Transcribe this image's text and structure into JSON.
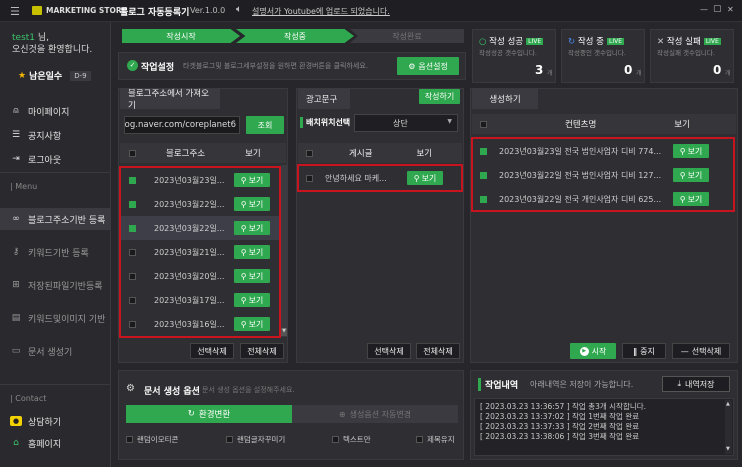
{
  "titlebar": {
    "brand": "MARKETING STORE",
    "app_title": "블로그 자동등록기",
    "version": "Ver.1.0.0",
    "notice": "설명서가 Youtube에 업로드 되었습니다.",
    "win_min": "—",
    "win_max": "▢",
    "win_close": "✕"
  },
  "sidebar": {
    "user": "test1",
    "user_suffix": "님,",
    "welcome": "오신것을 환영합니다.",
    "days_left_label": "남은일수",
    "days_left_value": "D-9",
    "items": [
      {
        "label": "마이페이지",
        "icon": "user-icon"
      },
      {
        "label": "공지사항",
        "icon": "list-icon"
      },
      {
        "label": "로그아웃",
        "icon": "logout-icon"
      }
    ],
    "menu_header": "| Menu",
    "menu": [
      {
        "label": "블로그주소기반 등록",
        "icon": "link-icon"
      },
      {
        "label": "키워드기반 등록",
        "icon": "key-icon"
      },
      {
        "label": "저장된파일기반등록",
        "icon": "file-plus-icon"
      },
      {
        "label": "키워드및이미지 기반",
        "icon": "image-doc-icon"
      },
      {
        "label": "문서 생성기",
        "icon": "doc-icon"
      }
    ],
    "contact_header": "| Contact",
    "contact": [
      {
        "label": "상담하기",
        "icon": "chat-icon"
      },
      {
        "label": "홈페이지",
        "icon": "home-icon"
      }
    ]
  },
  "steps": {
    "step1": "작성시작",
    "step2": "작성중",
    "step3": "작성완료"
  },
  "settings": {
    "label": "작업설정",
    "desc": "타겟블로그및 블로그세부설정을 원하면 환경버튼을 클릭하세요.",
    "button": "옵션설정"
  },
  "stats": [
    {
      "title": "작성 성공",
      "badge": "LIVE",
      "sub": "작성성공 갯수입니다.",
      "value": "3",
      "unit": "개"
    },
    {
      "title": "작성 중",
      "badge": "LIVE",
      "sub": "작성중인 갯수입니다.",
      "value": "0",
      "unit": "개"
    },
    {
      "title": "작성 실패",
      "badge": "LIVE",
      "sub": "작성실패 갯수입니다.",
      "value": "0",
      "unit": "개"
    }
  ],
  "blog_panel": {
    "tab": "블로그주소에서 가져오기",
    "url_value": "og.naver.com/coreplanet6",
    "search_button": "조회",
    "col_address": "블로그주소",
    "col_view": "보기",
    "rows": [
      {
        "text": "2023년03월23일...",
        "checked": true
      },
      {
        "text": "2023년03월22일...",
        "checked": true
      },
      {
        "text": "2023년03월22일...",
        "checked": true
      },
      {
        "text": "2023년03월21일...",
        "checked": false
      },
      {
        "text": "2023년03월20일...",
        "checked": false
      },
      {
        "text": "2023년03월17일...",
        "checked": false
      },
      {
        "text": "2023년03월16일...",
        "checked": false
      }
    ],
    "view_label": "보기",
    "delete_selected": "선택삭제",
    "delete_all": "전체삭제"
  },
  "ad_panel": {
    "tab": "광고문구",
    "write_button": "작성하기",
    "position_label": "배치위치선택",
    "position_value": "상단",
    "col_post": "게시글",
    "col_view": "보기",
    "rows": [
      {
        "text": "안녕하세요 마케...",
        "checked": false
      }
    ],
    "view_label": "보기",
    "delete_selected": "선택삭제",
    "delete_all": "전체삭제"
  },
  "generate_panel": {
    "tab": "생성하기",
    "col_title": "컨텐츠명",
    "col_view": "보기",
    "rows": [
      {
        "text": "2023년03월23일 전국 법인사업자 디비 774...",
        "checked": true
      },
      {
        "text": "2023년03월22일 전국 법인사업자 디비 127...",
        "checked": true
      },
      {
        "text": "2023년03월22일 전국 개인사업자 디비 625...",
        "checked": true
      }
    ],
    "view_label": "보기",
    "start": "시작",
    "stop": "중지",
    "delete_selected": "선택삭제"
  },
  "doc_options": {
    "title": "문서 생성 옵션",
    "desc": "문서 생성 옵션을 설정해주세요.",
    "env_tab": "환경변환",
    "auto_tab": "생성옵션 자동변경",
    "checks": [
      "랜덤이모티콘",
      "랜덤글자꾸미기",
      "텍스트만",
      "제목유지"
    ]
  },
  "work_log": {
    "title": "작업내역",
    "desc": "아래내역은 저장이 가능합니다.",
    "save_button": "내역저장",
    "lines": [
      "[ 2023.03.23 13:36:57 ] 작업 총3개 시작합니다.",
      "[ 2023.03.23 13:37:02 ] 작업 1번째 작업 완료",
      "[ 2023.03.23 13:37:33 ] 작업 2번째 작업 완료",
      "[ 2023.03.23 13:38:06 ] 작업 3번째 작업 완료"
    ]
  },
  "colors": {
    "accent": "#2fa84f",
    "highlight": "#c8141e"
  }
}
